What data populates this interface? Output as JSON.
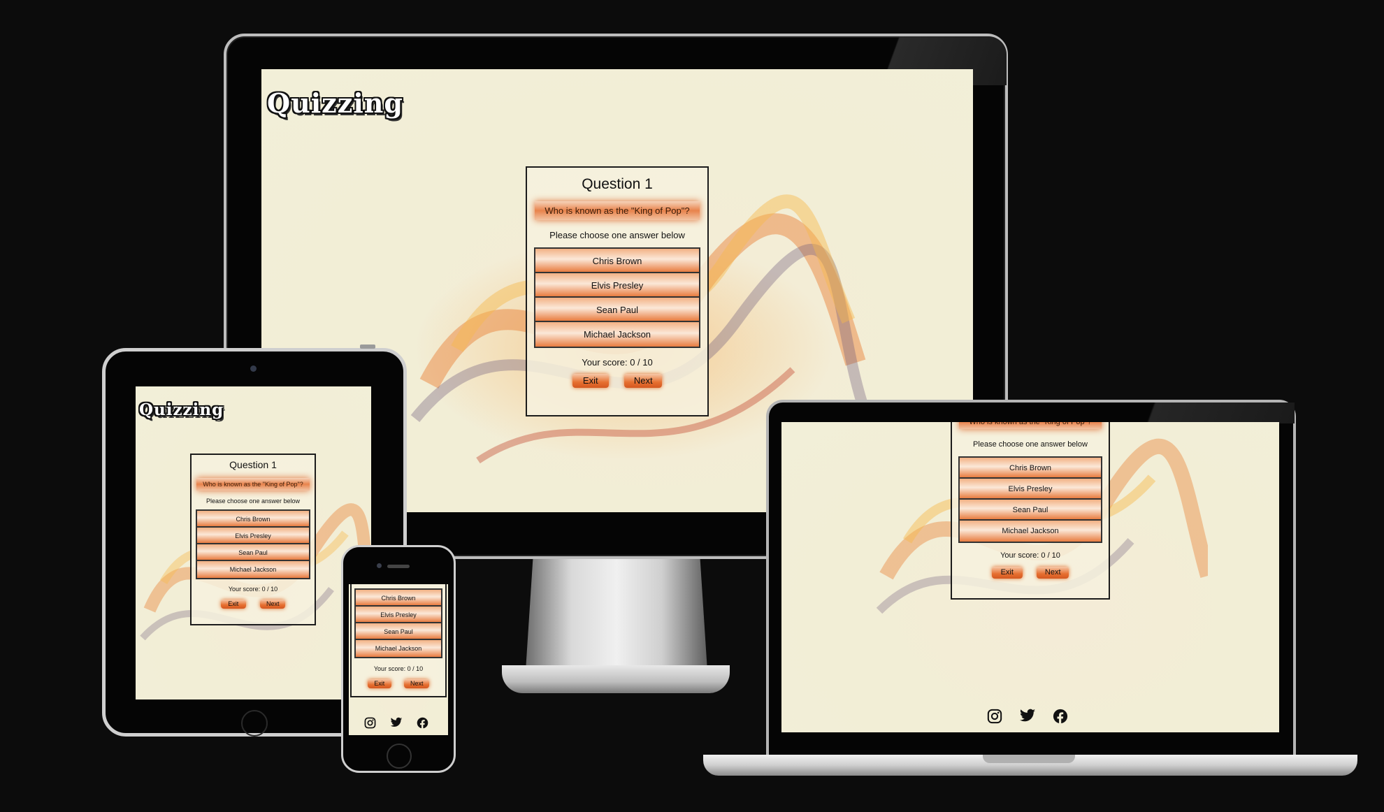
{
  "site": {
    "logo": "Quizzing"
  },
  "quiz": {
    "question_heading": "Question 1",
    "question_text": "Who is known as the \"King of Pop\"?",
    "instruction": "Please choose one answer below",
    "answers": [
      "Chris Brown",
      "Elvis Presley",
      "Sean Paul",
      "Michael Jackson"
    ],
    "score_label": "Your score:",
    "score_value": "0 / 10",
    "exit_label": "Exit",
    "next_label": "Next"
  },
  "social": {
    "icons": [
      "instagram-icon",
      "twitter-icon",
      "facebook-icon"
    ]
  },
  "colors": {
    "accent": "#e8783c",
    "page_bg": "#f2eed6",
    "backdrop": "#0c0c0c"
  }
}
